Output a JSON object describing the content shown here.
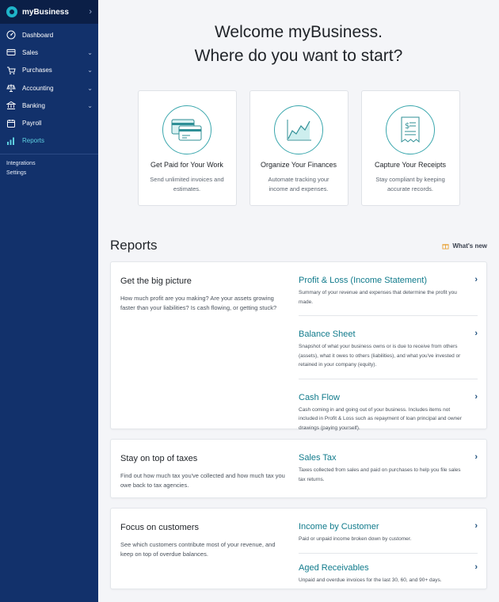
{
  "sidebar": {
    "brand": "myBusiness",
    "items": [
      {
        "label": "Dashboard",
        "icon": "dashboard-icon",
        "chevron": false
      },
      {
        "label": "Sales",
        "icon": "sales-icon",
        "chevron": true
      },
      {
        "label": "Purchases",
        "icon": "cart-icon",
        "chevron": true
      },
      {
        "label": "Accounting",
        "icon": "scale-icon",
        "chevron": true
      },
      {
        "label": "Banking",
        "icon": "bank-icon",
        "chevron": true
      },
      {
        "label": "Payroll",
        "icon": "payroll-icon",
        "chevron": false
      },
      {
        "label": "Reports",
        "icon": "reports-icon",
        "chevron": false,
        "active": true
      }
    ],
    "secondary": [
      "Integrations",
      "Settings"
    ]
  },
  "welcome": {
    "line1": "Welcome myBusiness.",
    "line2": "Where do you want to start?"
  },
  "cards": [
    {
      "title": "Get Paid for Your Work",
      "desc": "Send unlimited invoices and estimates.",
      "icon": "invoice-cards-icon"
    },
    {
      "title": "Organize Your Finances",
      "desc": "Automate tracking your income and expenses.",
      "icon": "chart-icon"
    },
    {
      "title": "Capture Your Receipts",
      "desc": "Stay compliant by keeping accurate records.",
      "icon": "receipt-icon"
    }
  ],
  "reports": {
    "title": "Reports",
    "whats_new": "What's new",
    "sections": [
      {
        "title": "Get the big picture",
        "desc": "How much profit are you making? Are your assets growing faster than your liabilities? Is cash flowing, or getting stuck?",
        "items": [
          {
            "title": "Profit & Loss (Income Statement)",
            "desc": "Summary of your revenue and expenses that determine the profit you made."
          },
          {
            "title": "Balance Sheet",
            "desc": "Snapshot of what your business owns or is due to receive from others (assets), what it owes to others (liabilities), and what you've invested or retained in your company (equity)."
          },
          {
            "title": "Cash Flow",
            "desc": "Cash coming in and going out of your business. Includes items not included in Profit & Loss such as repayment of loan principal and owner drawings (paying yourself)."
          }
        ]
      },
      {
        "title": "Stay on top of taxes",
        "desc": "Find out how much tax you've collected and how much tax you owe back to tax agencies.",
        "items": [
          {
            "title": "Sales Tax",
            "desc": "Taxes collected from sales and paid on purchases to help you file sales tax returns."
          }
        ]
      },
      {
        "title": "Focus on customers",
        "desc": "See which customers contribute most of your revenue, and keep on top of overdue balances.",
        "items": [
          {
            "title": "Income by Customer",
            "desc": "Paid or unpaid income broken down by customer."
          },
          {
            "title": "Aged Receivables",
            "desc": "Unpaid and overdue invoices for the last 30, 60, and 90+ days."
          }
        ]
      }
    ]
  },
  "colors": {
    "sidebar": "#12316b",
    "accent": "#117b8c",
    "active_nav": "#5ed0e0"
  }
}
